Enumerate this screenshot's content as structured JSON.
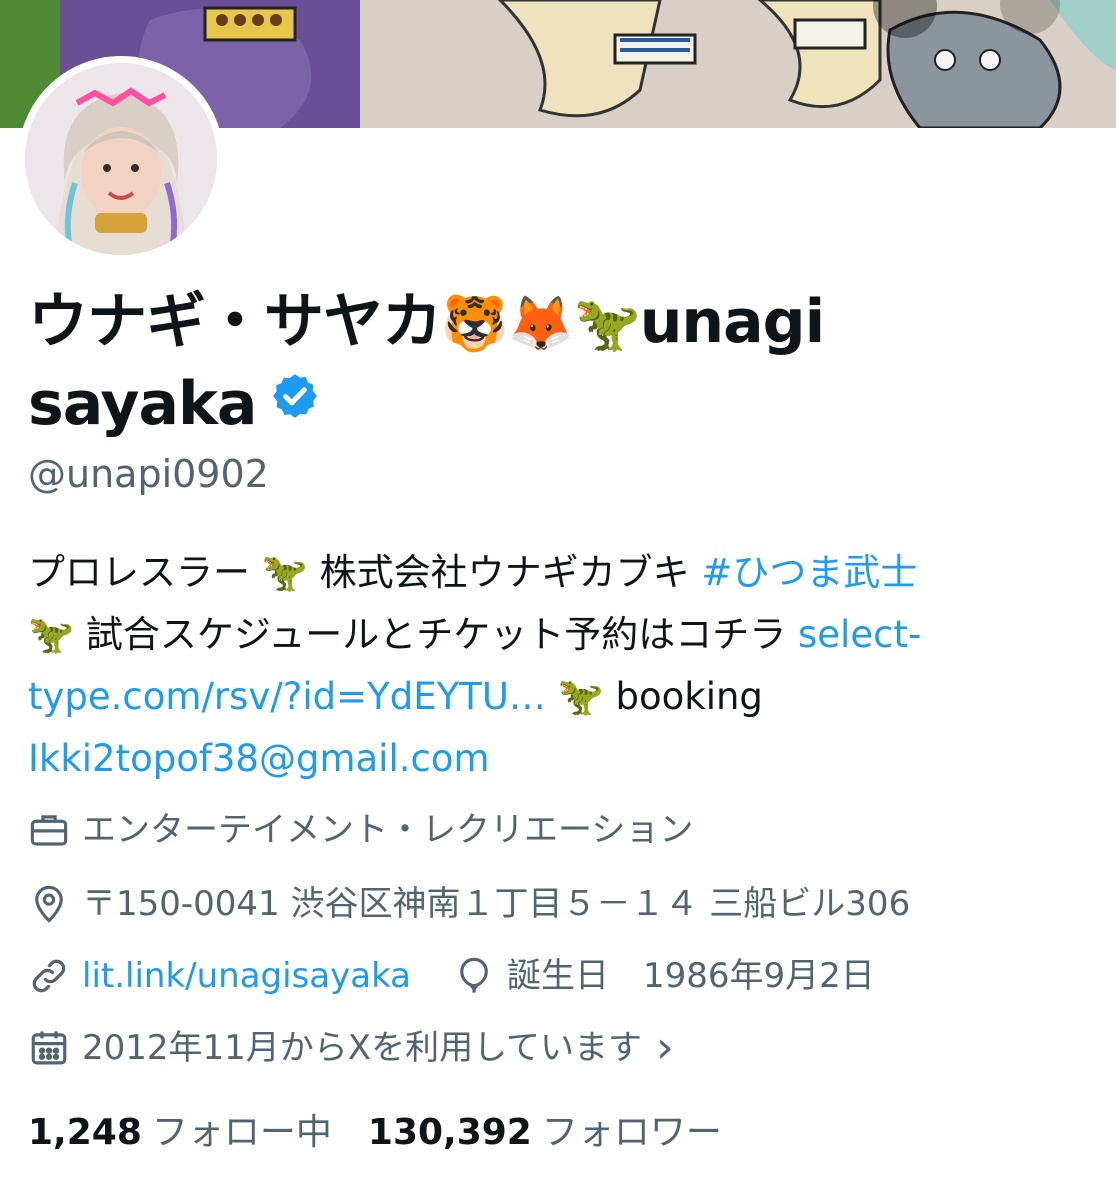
{
  "profile": {
    "name_part1": "ウナギ・サヤカ",
    "name_emojis": "🐯🦊🦖",
    "name_part2": "unagi",
    "name_line2": "sayaka",
    "handle": "@unapi0902"
  },
  "bio": {
    "text1": "プロレスラー 🦖 株式会社ウナギカブキ ",
    "hashtag": "#ひつま武士",
    "text2": "🦖 試合スケジュールとチケット予約はコチラ ",
    "link1": "select-type.com/rsv/?id=YdEYTU…",
    "text3": " 🦖 booking ",
    "email": "Ikki2topof38@gmail.com"
  },
  "meta": {
    "category": "エンターテイメント・レクリエーション",
    "location": "〒150-0041 渋谷区神南１丁目５－１４ 三船ビル306",
    "website": "lit.link/unagisayaka",
    "birthday": "誕生日　1986年9月2日",
    "joined": "2012年11月からXを利用しています",
    "joined_chevron": "›"
  },
  "stats": {
    "following_count": "1,248",
    "following_label": "フォロー中",
    "followers_count": "130,392",
    "followers_label": "フォロワー"
  },
  "colors": {
    "link": "#1d9bf0",
    "secondary_text": "#536471",
    "primary_text": "#0f1419",
    "verified": "#1d9bf0"
  },
  "icons": [
    "briefcase-icon",
    "location-pin-icon",
    "link-icon",
    "balloon-icon",
    "calendar-icon",
    "chevron-right-icon",
    "verified-badge-icon"
  ]
}
